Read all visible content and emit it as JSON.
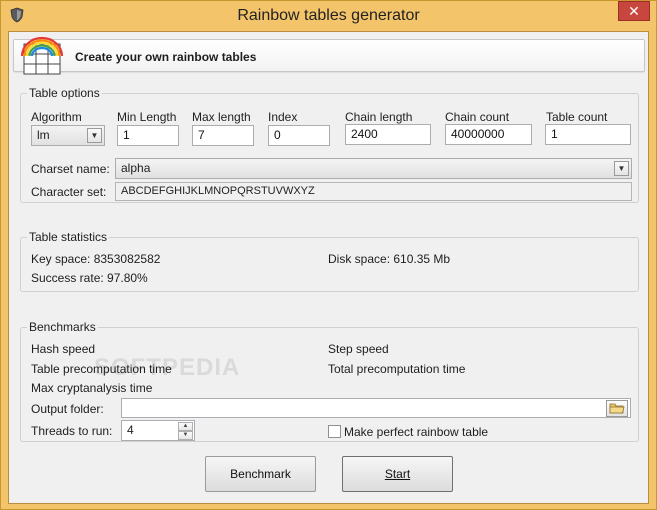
{
  "window": {
    "title": "Rainbow tables generator",
    "close_label": "✕"
  },
  "header": {
    "title": "Create your own rainbow tables"
  },
  "table_options": {
    "legend": "Table options",
    "algorithm": {
      "label": "Algorithm",
      "value": "lm"
    },
    "min_length": {
      "label": "Min Length",
      "value": "1"
    },
    "max_length": {
      "label": "Max length",
      "value": "7"
    },
    "index": {
      "label": "Index",
      "value": "0"
    },
    "chain_length": {
      "label": "Chain length",
      "value": "2400"
    },
    "chain_count": {
      "label": "Chain count",
      "value": "40000000"
    },
    "table_count": {
      "label": "Table count",
      "value": "1"
    },
    "charset_name": {
      "label": "Charset name:",
      "value": "alpha"
    },
    "character_set": {
      "label": "Character set:",
      "value": "ABCDEFGHIJKLMNOPQRSTUVWXYZ"
    }
  },
  "table_statistics": {
    "legend": "Table statistics",
    "key_space": "Key space: 8353082582",
    "disk_space": "Disk space: 610.35 Mb",
    "success_rate": "Success rate: 97.80%"
  },
  "benchmarks": {
    "legend": "Benchmarks",
    "hash_speed": "Hash speed",
    "step_speed": "Step speed",
    "table_precomputation_time": "Table precomputation time",
    "total_precomputation_time": "Total precomputation time",
    "max_cryptanalysis_time": "Max cryptanalysis time",
    "output_folder": {
      "label": "Output folder:",
      "value": ""
    },
    "threads": {
      "label": "Threads to run:",
      "value": "4"
    },
    "perfect_table": {
      "label": "Make perfect rainbow table",
      "checked": false
    }
  },
  "buttons": {
    "benchmark": "Benchmark",
    "start": "Start"
  },
  "colors": {
    "title_bar": "#f3c46a",
    "close_button": "#c7473e",
    "client_bg": "#f0f0f0"
  },
  "icons": {
    "app": "shield-icon",
    "header": "rainbow-grid-icon",
    "browse": "folder-icon"
  }
}
